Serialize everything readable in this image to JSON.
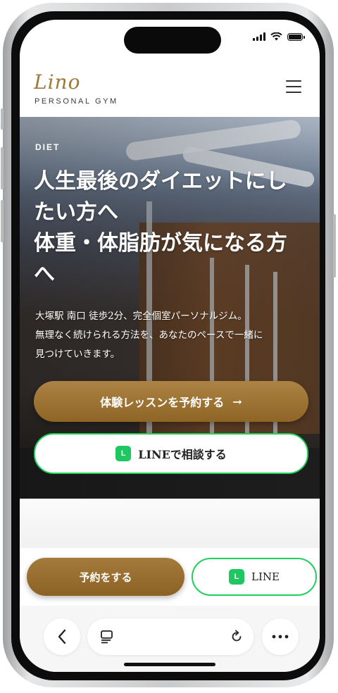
{
  "header": {
    "logo_script": "Lino",
    "logo_sub": "PERSONAL GYM",
    "menu_icon": "hamburger-menu-icon"
  },
  "hero": {
    "tag": "DIET",
    "title_lines": [
      "人生最後のダイエットにし",
      "たい方へ",
      "体重・体脂肪が気になる方",
      "へ"
    ],
    "desc_lines": [
      "大塚駅 南口 徒歩2分、完全個室パーソナルジム。",
      "無理なく続けられる方法を、あなたのペースで一緒に",
      "見つけていきます。"
    ],
    "primary_button": "体験レッスンを予約する",
    "primary_arrow": "→",
    "line_button": "LINEで相談する",
    "line_badge": "L"
  },
  "sticky_bar": {
    "reserve_button": "予約をする",
    "line_button": "LINE",
    "line_badge": "L"
  },
  "browser_bar": {
    "back_icon": "chevron-left-icon",
    "tabs_icon": "tab-overview-icon",
    "reload_icon": "reload-icon",
    "more_icon": "more-dots-icon"
  },
  "colors": {
    "brand_gold": "#a0793a",
    "line_green": "#1fcf5b"
  }
}
